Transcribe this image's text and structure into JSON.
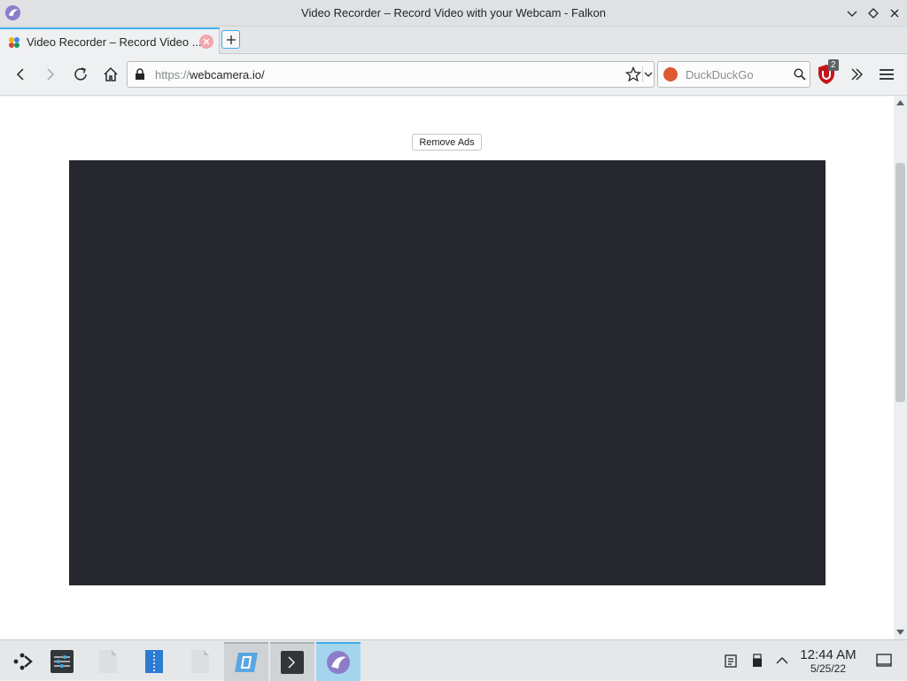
{
  "window": {
    "title": "Video Recorder – Record Video with your Webcam - Falkon"
  },
  "tabs": [
    {
      "label": "Video Recorder – Record Video ...",
      "active": true
    }
  ],
  "toolbar": {
    "url_protocol": "https://",
    "url_host": "webcamera.io/",
    "search_placeholder": "DuckDuckGo",
    "ublock_badge": "2"
  },
  "page": {
    "remove_ads_label": "Remove Ads",
    "video_background": "#26282e"
  },
  "taskbar": {
    "time": "12:44 AM",
    "date": "5/25/22"
  },
  "colors": {
    "accent": "#3daee9",
    "tab_close": "#f2a6ad",
    "duckduckgo": "#de5833",
    "ublock": "#c4151b"
  }
}
